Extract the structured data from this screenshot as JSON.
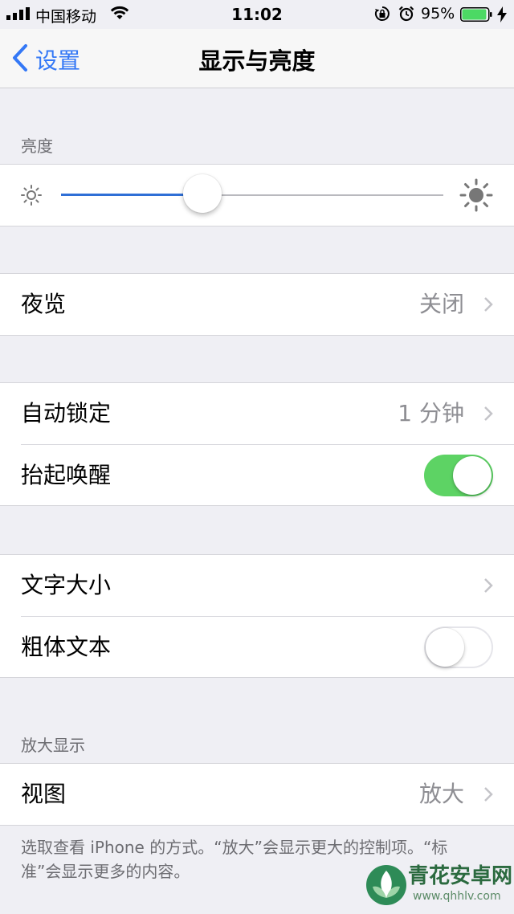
{
  "status_bar": {
    "carrier": "中国移动",
    "time": "11:02",
    "battery_percent": "95%",
    "battery_level": 0.95,
    "icons": [
      "signal-icon",
      "wifi-icon",
      "orientation-lock-icon",
      "alarm-icon",
      "battery-icon",
      "charging-icon"
    ]
  },
  "nav": {
    "back_label": "设置",
    "title": "显示与亮度"
  },
  "brightness": {
    "header": "亮度",
    "level": 0.37,
    "icons": [
      "sun-small-icon",
      "sun-large-icon"
    ]
  },
  "night_shift": {
    "label": "夜览",
    "value": "关闭"
  },
  "auto_lock": {
    "label": "自动锁定",
    "value": "1 分钟"
  },
  "raise_to_wake": {
    "label": "抬起唤醒",
    "on": true
  },
  "text_size": {
    "label": "文字大小"
  },
  "bold_text": {
    "label": "粗体文本",
    "on": false
  },
  "zoom": {
    "header": "放大显示",
    "view_label": "视图",
    "view_value": "放大",
    "footer": "选取查看 iPhone 的方式。“放大”会显示更大的控制项。“标准”会显示更多的内容。"
  },
  "watermark": {
    "name": "青花安卓网",
    "url": "www.qhhlv.com"
  },
  "colors": {
    "accent": "#3478f6",
    "toggle_on": "#5dd364",
    "slider_fill": "#2f6fd6",
    "background": "#efeff4",
    "secondary_text": "#8e8e93"
  }
}
